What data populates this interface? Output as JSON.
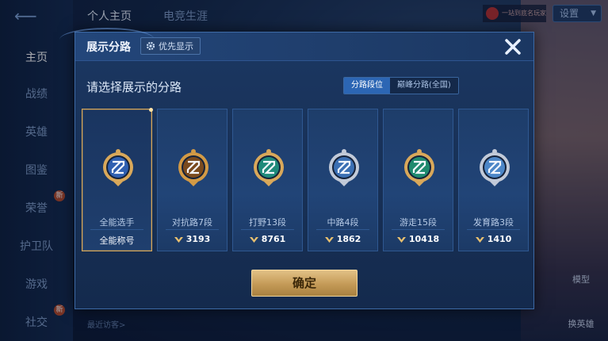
{
  "background": {
    "back_label": "⟵",
    "top_tabs": [
      {
        "label": "个人主页",
        "active": true
      },
      {
        "label": "电竞生涯",
        "active": false
      }
    ],
    "nav_items": [
      {
        "label": "主页",
        "active": true,
        "badge": ""
      },
      {
        "label": "战绩",
        "active": false,
        "badge": ""
      },
      {
        "label": "英雄",
        "active": false,
        "badge": ""
      },
      {
        "label": "图鉴",
        "active": false,
        "badge": ""
      },
      {
        "label": "荣誉",
        "active": false,
        "badge": "新"
      },
      {
        "label": "护卫队",
        "active": false,
        "badge": ""
      },
      {
        "label": "游戏",
        "active": false,
        "badge": ""
      },
      {
        "label": "社交",
        "active": false,
        "badge": "新"
      }
    ],
    "settings_label": "设置",
    "avatar_text": "一站到底名玩家",
    "recent_visitors_label": "最近访客>",
    "side_labels": [
      "模型",
      "换英雄"
    ]
  },
  "modal": {
    "title": "展示分路",
    "priority_button": "优先显示",
    "subtitle": "请选择展示的分路",
    "toggle_options": [
      {
        "label": "分路段位",
        "active": true
      },
      {
        "label": "巅峰分路(全国)",
        "active": false
      }
    ],
    "cards": [
      {
        "name": "全能选手",
        "footer": "全能称号",
        "score": "",
        "selected": true,
        "emblem": "all-round-emblem-icon",
        "ring": "#d9a85a",
        "core": "#2f5fb0"
      },
      {
        "name": "对抗路7段",
        "footer": "",
        "score": "3193",
        "selected": false,
        "emblem": "clash-lane-emblem-icon",
        "ring": "#d39a45",
        "core": "#7a4a1e"
      },
      {
        "name": "打野13段",
        "footer": "",
        "score": "8761",
        "selected": false,
        "emblem": "jungle-emblem-icon",
        "ring": "#d9a85a",
        "core": "#1f8a7a"
      },
      {
        "name": "中路4段",
        "footer": "",
        "score": "1862",
        "selected": false,
        "emblem": "mid-lane-emblem-icon",
        "ring": "#c2cad8",
        "core": "#3b6fb3"
      },
      {
        "name": "游走15段",
        "footer": "",
        "score": "10418",
        "selected": false,
        "emblem": "roam-emblem-icon",
        "ring": "#d9a85a",
        "core": "#1f8a6e"
      },
      {
        "name": "发育路3段",
        "footer": "",
        "score": "1410",
        "selected": false,
        "emblem": "farm-lane-emblem-icon",
        "ring": "#c2cad8",
        "core": "#4c86c7"
      }
    ],
    "confirm_button": "确定"
  },
  "colors": {
    "accent_gold": "#d9a858",
    "toggle_active": "#2c66b4",
    "modal_bg": "#183157"
  }
}
